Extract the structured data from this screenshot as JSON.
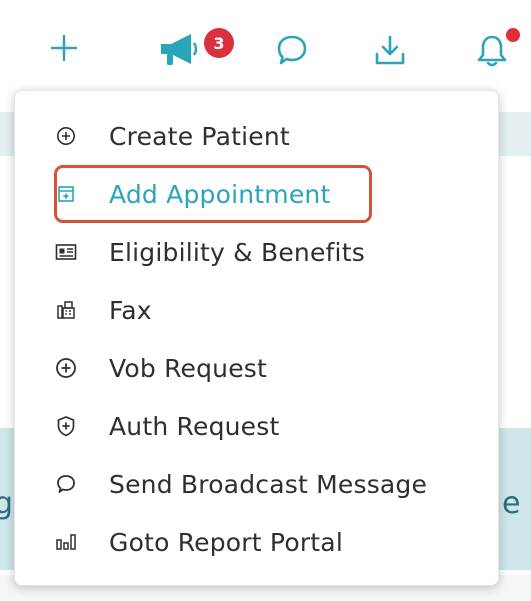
{
  "toolbar": {
    "icons": [
      "plus-icon",
      "megaphone-icon",
      "chat-bubble-icon",
      "download-icon",
      "bell-icon"
    ],
    "announcement_count": "3",
    "accent": "#2aa5b8",
    "badge_color": "#d8323f"
  },
  "background": {
    "banner_left_fragment": "g",
    "banner_right_fragment": "e W"
  },
  "menu": {
    "items": [
      {
        "label": "Create Patient",
        "icon": "plus-circle-icon"
      },
      {
        "label": "Add Appointment",
        "icon": "calendar-add-icon",
        "highlighted": true
      },
      {
        "label": "Eligibility & Benefits",
        "icon": "id-card-icon"
      },
      {
        "label": "Fax",
        "icon": "fax-icon"
      },
      {
        "label": "Vob Request",
        "icon": "plus-circle-icon"
      },
      {
        "label": "Auth Request",
        "icon": "shield-plus-icon"
      },
      {
        "label": "Send Broadcast Message",
        "icon": "chat-bubble-icon"
      },
      {
        "label": "Goto Report Portal",
        "icon": "bar-chart-icon"
      }
    ],
    "highlight_color": "#d5523c",
    "active_color": "#2aa5b8"
  }
}
